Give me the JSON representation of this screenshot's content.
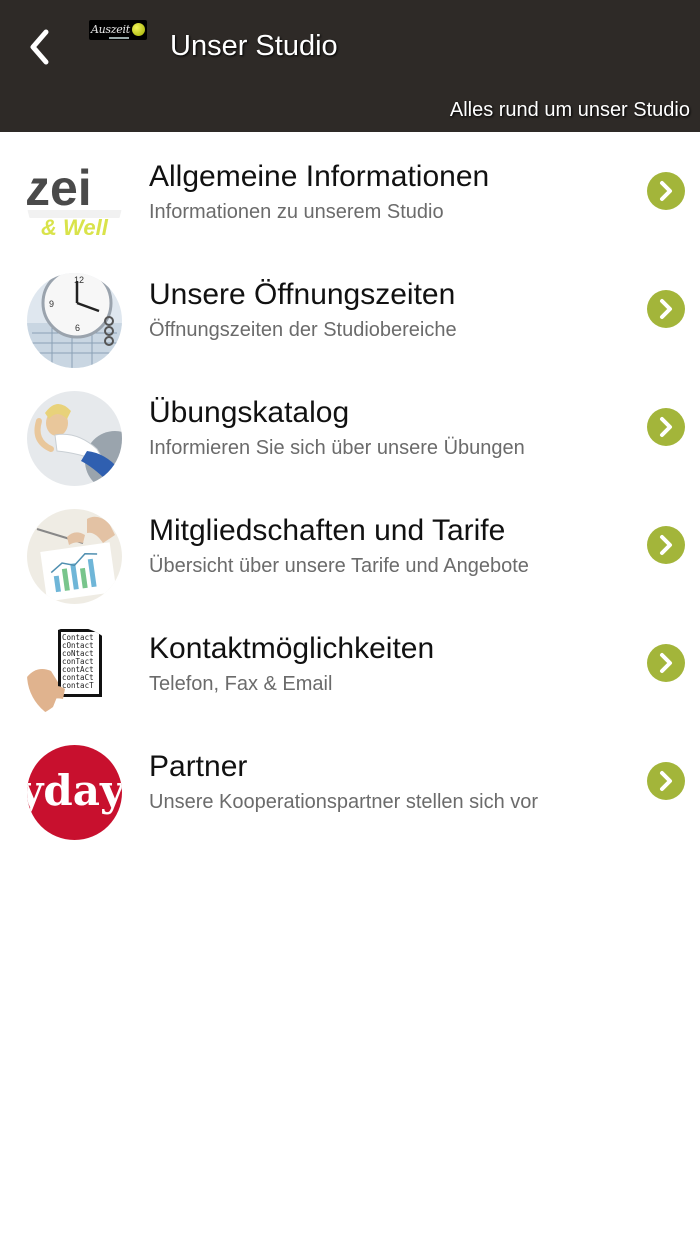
{
  "header": {
    "title": "Unser Studio",
    "subtitle": "Alles rund um unser Studio",
    "logo_text": "Auszeit",
    "background": "#2e2a27",
    "back_icon": "chevron-left-icon"
  },
  "accent_color": "#a3b53a",
  "items": [
    {
      "title": "Allgemeine Informationen",
      "subtitle": "Informationen zu unserem Studio",
      "thumb_text": "zei",
      "thumb_text2": "& Well"
    },
    {
      "title": "Unsere Öffnungszeiten",
      "subtitle": "Öffnungszeiten der Studiobereiche"
    },
    {
      "title": "Übungskatalog",
      "subtitle": "Informieren Sie sich über unsere Übungen"
    },
    {
      "title": "Mitgliedschaften und Tarife",
      "subtitle": "Übersicht über unsere Tarife und Angebote"
    },
    {
      "title": "Kontaktmöglichkeiten",
      "subtitle": "Telefon, Fax & Email",
      "thumb_lines": [
        "Contact",
        "cOntact",
        "coNtact",
        "conTact",
        "contAct",
        "contaCt",
        "contacT"
      ]
    },
    {
      "title": "Partner",
      "subtitle": "Unsere Kooperationspartner stellen sich vor",
      "thumb_text": "yday"
    }
  ]
}
